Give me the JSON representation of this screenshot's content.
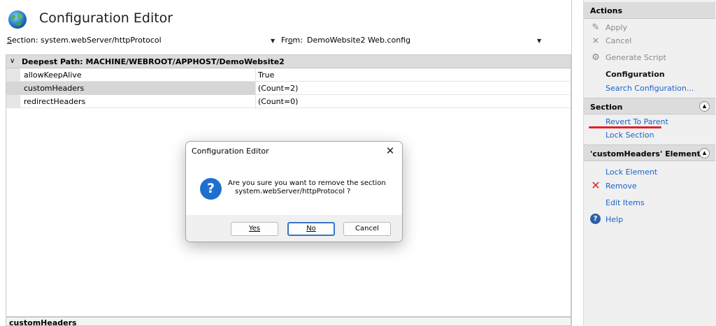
{
  "main": {
    "title": "Configuration Editor",
    "section_label_prefix": "S",
    "section_label_rest": "ection:",
    "section_value": "system.webServer/httpProtocol",
    "from_label_prefix": "Fr",
    "from_label_u": "o",
    "from_label_rest": "m:",
    "from_value": "DemoWebsite2 Web.config",
    "grid_header": "Deepest Path: MACHINE/WEBROOT/APPHOST/DemoWebsite2",
    "rows": [
      {
        "name": "allowKeepAlive",
        "value": "True"
      },
      {
        "name": "customHeaders",
        "value": "(Count=2)"
      },
      {
        "name": "redirectHeaders",
        "value": "(Count=0)"
      }
    ],
    "bottom_label": "customHeaders"
  },
  "dialog": {
    "title": "Configuration Editor",
    "close_glyph": "✕",
    "icon_glyph": "?",
    "message_line1": "Are you sure you want to remove the section",
    "message_line2": "system.webServer/httpProtocol ?",
    "yes_label": "Yes",
    "no_label": "No",
    "cancel_label": "Cancel"
  },
  "actions": {
    "header": "Actions",
    "apply": "Apply",
    "cancel": "Cancel",
    "generate_script": "Generate Script",
    "configuration": "Configuration",
    "search_configuration": "Search Configuration...",
    "section_header": "Section",
    "revert_to_parent": "Revert To Parent",
    "lock_section": "Lock Section",
    "element_header": "'customHeaders' Element",
    "lock_element": "Lock Element",
    "remove": "Remove",
    "edit_items": "Edit Items",
    "help": "Help"
  },
  "colors": {
    "link": "#1a63c7",
    "dialog_accent": "#3b73c8",
    "remove_icon": "#d8262b",
    "annotation": "#e3202a"
  },
  "icons": [
    "globe-icon",
    "dropdown-arrow-icon",
    "chevron-down-icon",
    "question-icon",
    "close-icon",
    "apply-icon",
    "cancel-icon",
    "generate-script-icon",
    "collapse-icon",
    "remove-icon",
    "help-icon"
  ]
}
